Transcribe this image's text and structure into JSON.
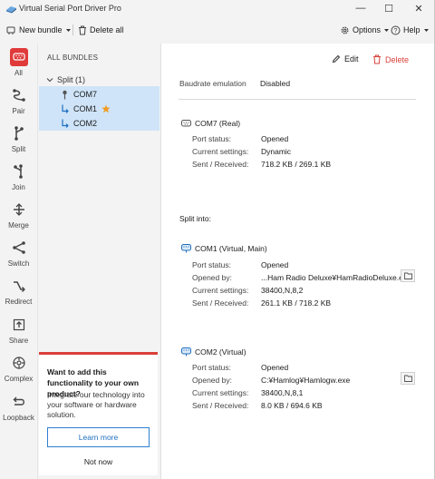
{
  "window": {
    "title": "Virtual Serial Port Driver Pro",
    "minimize_glyph": "—",
    "maximize_glyph": "☐",
    "close_glyph": "✕"
  },
  "toolbar": {
    "new_bundle": "New bundle",
    "delete_all": "Delete all",
    "options": "Options",
    "help": "Help"
  },
  "rail": [
    {
      "label": "All",
      "icon": "serial-port-icon"
    },
    {
      "label": "Pair",
      "icon": "pair-icon"
    },
    {
      "label": "Split",
      "icon": "split-icon"
    },
    {
      "label": "Join",
      "icon": "join-icon"
    },
    {
      "label": "Merge",
      "icon": "merge-icon"
    },
    {
      "label": "Switch",
      "icon": "switch-icon"
    },
    {
      "label": "Redirect",
      "icon": "redirect-icon"
    },
    {
      "label": "Share",
      "icon": "share-icon"
    },
    {
      "label": "Complex",
      "icon": "complex-icon"
    },
    {
      "label": "Loopback",
      "icon": "loopback-icon"
    }
  ],
  "tree": {
    "header": "ALL BUNDLES",
    "group": "Split (1)",
    "items": [
      "COM7",
      "COM1",
      "COM2"
    ]
  },
  "promo": {
    "title": "Want to add this functionality to your own product?",
    "text": "Integrate our technology into your software or hardware solution.",
    "learn_more": "Learn more",
    "not_now": "Not now"
  },
  "details": {
    "edit": "Edit",
    "delete": "Delete",
    "baudrate_label": "Baudrate emulation",
    "baudrate_value": "Disabled",
    "com7": {
      "title": "COM7 (Real)",
      "port_status_label": "Port status:",
      "port_status": "Opened",
      "settings_label": "Current settings:",
      "settings": "Dynamic",
      "sent_label": "Sent / Received:",
      "sent": "718.2 KB / 269.1 KB"
    },
    "split_into": "Split into:",
    "com1": {
      "title": "COM1 (Virtual, Main)",
      "port_status_label": "Port status:",
      "port_status": "Opened",
      "opened_by_label": "Opened by:",
      "opened_by": "...Ham Radio Deluxe¥HamRadioDeluxe.exe",
      "settings_label": "Current settings:",
      "settings": "38400,N,8,2",
      "sent_label": "Sent / Received:",
      "sent": "261.1 KB / 718.2 KB"
    },
    "com2": {
      "title": "COM2 (Virtual)",
      "port_status_label": "Port status:",
      "port_status": "Opened",
      "opened_by_label": "Opened by:",
      "opened_by": "C:¥Hamlog¥Hamlogw.exe",
      "settings_label": "Current settings:",
      "settings": "38400,N,8,1",
      "sent_label": "Sent / Received:",
      "sent": "8.0 KB / 694.6 KB"
    }
  },
  "colors": {
    "accent": "#e03a3a",
    "selection": "#cfe4f8",
    "link": "#1f6fc0"
  }
}
